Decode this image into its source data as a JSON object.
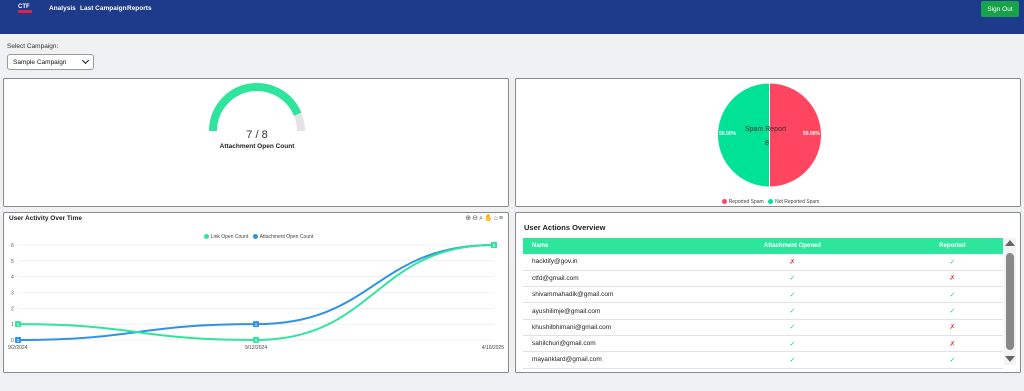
{
  "nav": {
    "logo_text": "CTF",
    "links": [
      "Analysis",
      "Last Campaign",
      "Reports"
    ],
    "signout": "Sign Out"
  },
  "campaign": {
    "label": "Select Campaign:",
    "selected": "Sample Campaign"
  },
  "gauge": {
    "value": "7 / 8",
    "label": "Attachment Open Count",
    "opened": 7,
    "total": 8
  },
  "pie": {
    "title": "Spam Report",
    "value": "8",
    "left_label": "50.00%",
    "right_label": "50.00%",
    "legend": [
      "Reported Spam",
      "Not Reported Spam"
    ],
    "colors": {
      "reported": "#ff4560",
      "not_reported": "#00e396"
    }
  },
  "chart_data": {
    "type": "line",
    "title": "User Activity Over Time",
    "categories": [
      "9/2/2024",
      "9/12/2024",
      "4/10/2025"
    ],
    "series": [
      {
        "name": "Link Open Count",
        "values": [
          1,
          0,
          6
        ],
        "color": "#2ee59d"
      },
      {
        "name": "Attachment Open Count",
        "values": [
          0,
          1,
          6
        ],
        "color": "#2e93e8"
      }
    ],
    "y_ticks": [
      "0",
      "1",
      "2",
      "3",
      "4",
      "5",
      "6"
    ],
    "ylim": [
      0,
      6
    ],
    "grid": true,
    "legend": "top-center"
  },
  "toolbar_icons": [
    "zoom-in-icon",
    "zoom-out-icon",
    "magnifier-icon",
    "pan-icon",
    "home-icon",
    "menu-icon"
  ],
  "table": {
    "title": "User Actions Overview",
    "headers": [
      "Name",
      "Attachment Opened",
      "Reported"
    ],
    "rows": [
      {
        "name": "hacktify@gov.in",
        "opened": "✗",
        "reported": "✓"
      },
      {
        "name": "ctfd@gmail.com",
        "opened": "✓",
        "reported": "✗"
      },
      {
        "name": "shivammahadik@gmail.com",
        "opened": "✓",
        "reported": "✓"
      },
      {
        "name": "ayushilimje@gmail.com",
        "opened": "✓",
        "reported": "✓"
      },
      {
        "name": "khushilbhimani@gmail.com",
        "opened": "✓",
        "reported": "✗"
      },
      {
        "name": "sahilchuri@gmail.com",
        "opened": "✓",
        "reported": "✗"
      },
      {
        "name": "mayanklard@gmail.com",
        "opened": "✓",
        "reported": "✓"
      }
    ]
  }
}
